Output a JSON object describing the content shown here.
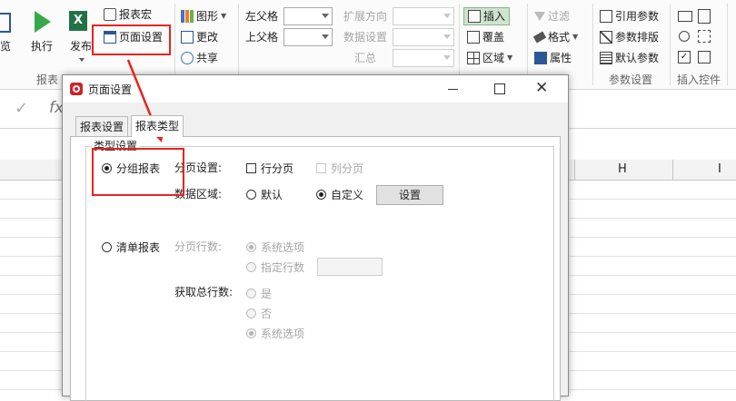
{
  "ribbon": {
    "preview_label": "预览",
    "execute_label": "执行",
    "publish_label": "发布",
    "report_label": "报表宏",
    "page_setup_label": "页面设置",
    "group_report": "报表",
    "chart_label": "图形",
    "change_label": "更改",
    "share_label": "共享",
    "left_parent_label": "左父格",
    "top_parent_label": "上父格",
    "expand_dir_label": "扩展方向",
    "data_setting_label": "数据设置",
    "summary_label": "汇总",
    "insert_label": "插入",
    "cover_label": "覆盖",
    "area_label": "区域",
    "filter_label": "过滤",
    "format_label": "格式",
    "attr_label": "属性",
    "ref_param_label": "引用参数",
    "param_layout_label": "参数排版",
    "default_param_label": "默认参数",
    "group_param": "参数设置",
    "group_insert_ctrl": "插入控件"
  },
  "formula": {
    "check_icon": "✓",
    "fx": "fx"
  },
  "sheet": {
    "col_h": "H",
    "col_i": "I"
  },
  "dialog": {
    "title": "页面设置",
    "tabs": [
      "报表设置",
      "报表类型"
    ],
    "group_title": "类型设置",
    "grouped_report": "分组报表",
    "paging_label": "分页设置:",
    "row_paging": "行分页",
    "col_paging": "列分页",
    "data_area_label": "数据区域:",
    "default_opt": "默认",
    "custom_opt": "自定义",
    "setting_btn": "设置",
    "list_report": "清单报表",
    "page_rows_label": "分页行数:",
    "system_option": "系统选项",
    "specify_rows": "指定行数",
    "total_rows_label": "获取总行数:",
    "yes_opt": "是",
    "no_opt": "否",
    "system_option2": "系统选项"
  },
  "colors": {
    "highlight": "#e8231f",
    "excel_green": "#217346",
    "accent_blue": "#2b5797"
  }
}
